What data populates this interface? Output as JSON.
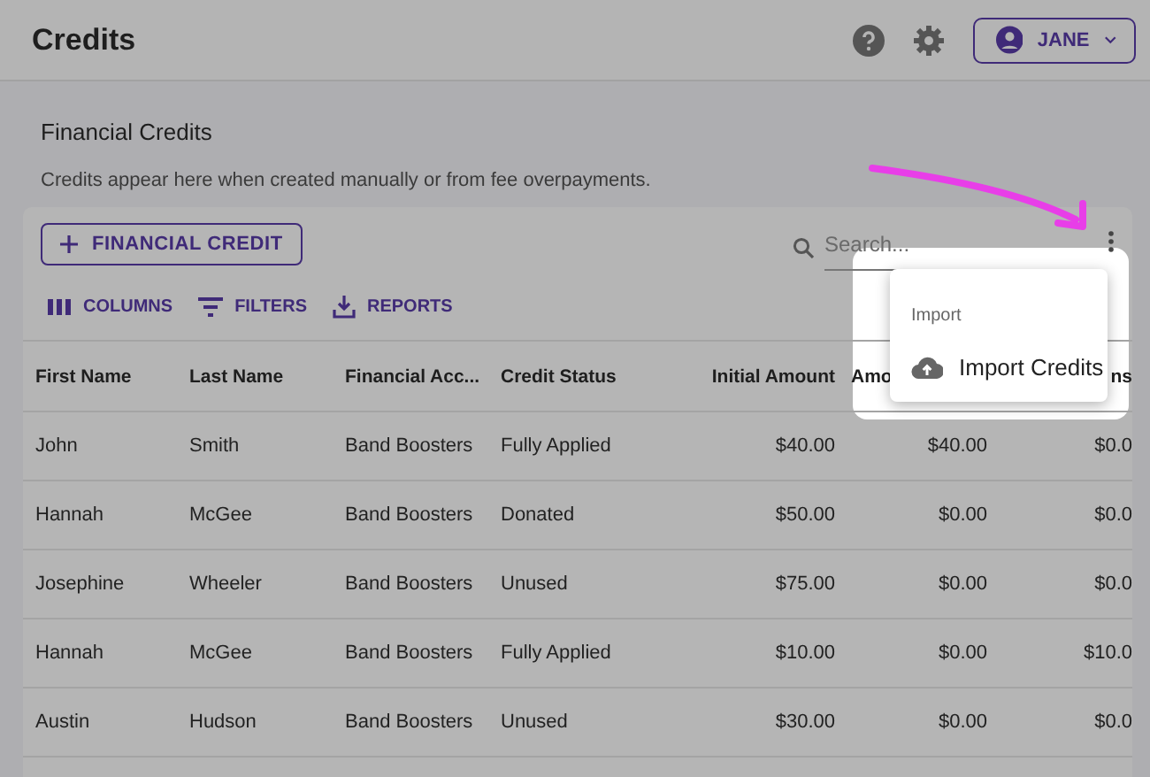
{
  "header": {
    "title": "Credits",
    "user_button": "JANE"
  },
  "section": {
    "title": "Financial Credits",
    "description": "Credits appear here when created manually or from fee overpayments."
  },
  "toolbar": {
    "add_button": "FINANCIAL CREDIT",
    "search": {
      "placeholder": "Search..."
    },
    "actions": [
      {
        "kind": "columns",
        "label": "COLUMNS"
      },
      {
        "kind": "filters",
        "label": "FILTERS"
      },
      {
        "kind": "reports",
        "label": "REPORTS"
      }
    ]
  },
  "table": {
    "columns": [
      "First Name",
      "Last Name",
      "Financial Acc...",
      "Credit Status",
      "Initial Amount",
      "Amo",
      "ns"
    ],
    "rows": [
      [
        "John",
        "Smith",
        "Band Boosters",
        "Fully Applied",
        "$40.00",
        "$40.00",
        "$0.0"
      ],
      [
        "Hannah",
        "McGee",
        "Band Boosters",
        "Donated",
        "$50.00",
        "$0.00",
        "$0.0"
      ],
      [
        "Josephine",
        "Wheeler",
        "Band Boosters",
        "Unused",
        "$75.00",
        "$0.00",
        "$0.0"
      ],
      [
        "Hannah",
        "McGee",
        "Band Boosters",
        "Fully Applied",
        "$10.00",
        "$0.00",
        "$10.0"
      ],
      [
        "Austin",
        "Hudson",
        "Band Boosters",
        "Unused",
        "$30.00",
        "$0.00",
        "$0.0"
      ]
    ]
  },
  "menu": {
    "section_label": "Import",
    "items": [
      {
        "label": "Import Credits"
      }
    ]
  }
}
